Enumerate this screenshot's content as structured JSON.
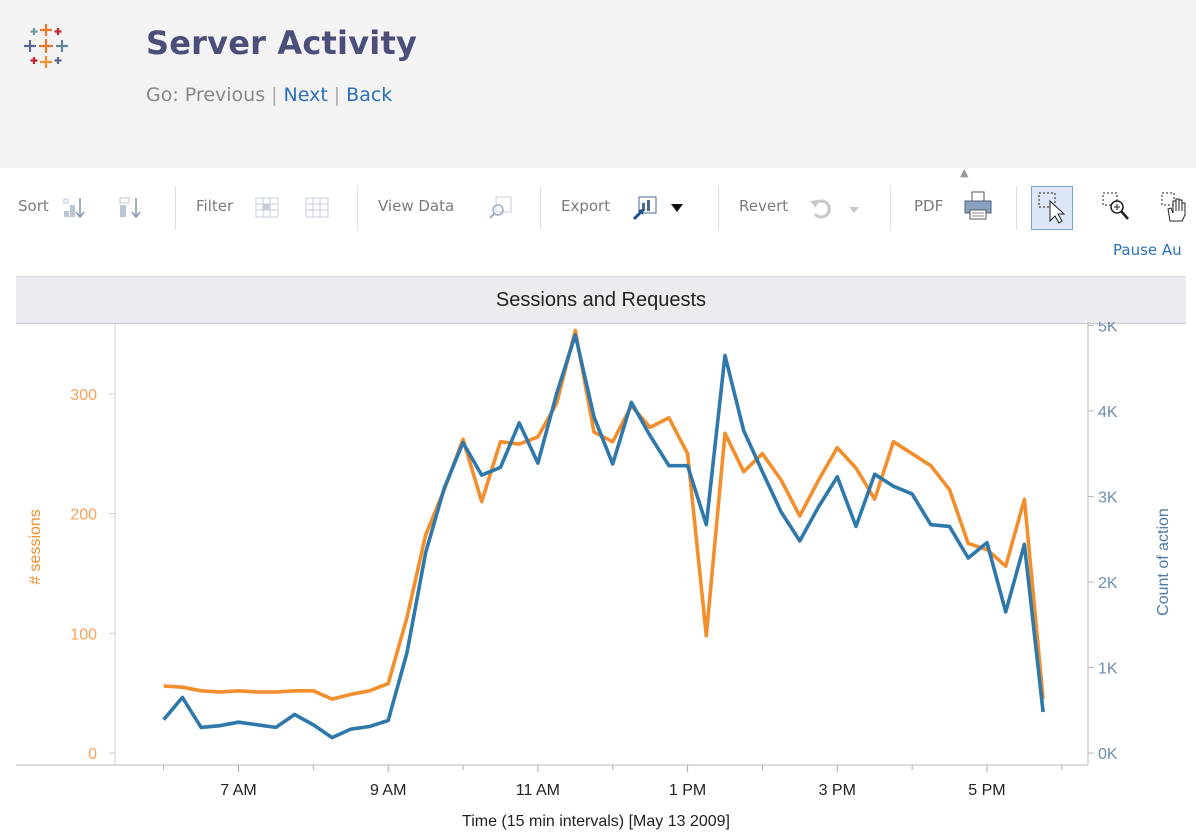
{
  "header": {
    "title": "Server Activity",
    "nav_prefix": "Go:",
    "nav_previous": "Previous",
    "nav_next": "Next",
    "nav_back": "Back",
    "logo_icon": "tableau-logo-icon"
  },
  "toolbar": {
    "sort_label": "Sort",
    "filter_label": "Filter",
    "view_data_label": "View Data",
    "export_label": "Export",
    "revert_label": "Revert",
    "pdf_label": "PDF",
    "pause_label": "Pause Au"
  },
  "colors": {
    "sessions": "#f28e2b",
    "actions": "#2e78ab",
    "title": "#4b4e79",
    "link": "#2a70b8"
  },
  "chart_data": {
    "type": "line",
    "title": "Sessions and Requests",
    "xlabel": "Time (15 min intervals) [May 13 2009]",
    "x_ticks": [
      "7 AM",
      "9 AM",
      "11 AM",
      "1 PM",
      "3 PM",
      "5 PM"
    ],
    "x_tick_hours": [
      7,
      9,
      11,
      13,
      15,
      17
    ],
    "x": [
      6.0,
      6.25,
      6.5,
      6.75,
      7.0,
      7.25,
      7.5,
      7.75,
      8.0,
      8.25,
      8.5,
      8.75,
      9.0,
      9.25,
      9.5,
      9.75,
      10.0,
      10.25,
      10.5,
      10.75,
      11.0,
      11.25,
      11.5,
      11.75,
      12.0,
      12.25,
      12.5,
      12.75,
      13.0,
      13.25,
      13.5,
      13.75,
      14.0,
      14.25,
      14.5,
      14.75,
      15.0,
      15.25,
      15.5,
      15.75,
      16.0,
      16.25,
      16.5,
      16.75,
      17.0,
      17.25,
      17.5,
      17.75
    ],
    "xlim": [
      5.35,
      18.35
    ],
    "y_left": {
      "label": "# sessions",
      "ticks": [
        "0",
        "100",
        "200",
        "300"
      ],
      "tick_values": [
        0,
        100,
        200,
        300
      ],
      "ylim": [
        -10,
        360
      ]
    },
    "y_right": {
      "label": "Count of action",
      "ticks": [
        "0K",
        "1K",
        "2K",
        "3K",
        "4K",
        "5K"
      ],
      "tick_values": [
        0,
        1000,
        2000,
        3000,
        4000,
        5000
      ],
      "ylim": [
        -140,
        5040
      ]
    },
    "series": [
      {
        "name": "# sessions",
        "axis": "left",
        "values": [
          56,
          55,
          52,
          51,
          52,
          51,
          51,
          52,
          52,
          45,
          49,
          52,
          58,
          113,
          182,
          220,
          262,
          210,
          260,
          258,
          264,
          292,
          353,
          268,
          260,
          290,
          272,
          280,
          250,
          98,
          267,
          235,
          250,
          228,
          198,
          228,
          255,
          238,
          212,
          260,
          250,
          240,
          220,
          175,
          170,
          156,
          212,
          45
        ]
      },
      {
        "name": "Count of action",
        "axis": "right",
        "values": [
          390,
          650,
          300,
          320,
          360,
          330,
          300,
          450,
          330,
          180,
          280,
          310,
          380,
          1170,
          2340,
          3100,
          3630,
          3250,
          3340,
          3860,
          3390,
          4200,
          4890,
          3930,
          3380,
          4100,
          3710,
          3360,
          3360,
          2670,
          4650,
          3770,
          3290,
          2820,
          2480,
          2880,
          3230,
          2650,
          3260,
          3120,
          3030,
          2670,
          2650,
          2280,
          2460,
          1650,
          2440,
          480
        ]
      }
    ]
  }
}
